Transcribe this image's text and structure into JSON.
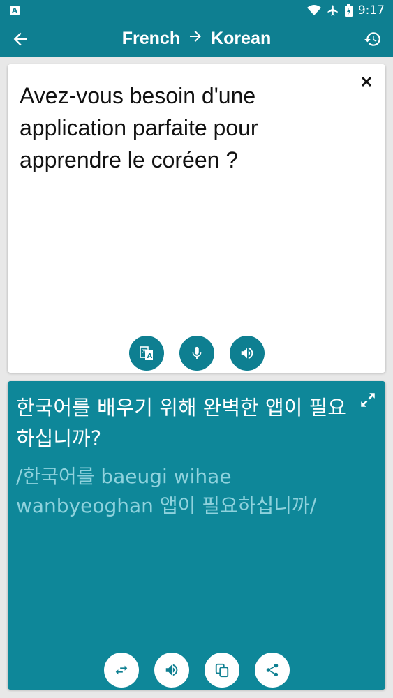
{
  "status": {
    "notification_icon": "app-notification-icon",
    "time": "9:17"
  },
  "appbar": {
    "source_language": "French",
    "target_language": "Korean",
    "back_icon": "arrow-left-icon",
    "arrow_icon": "arrow-right-icon",
    "history_icon": "history-icon"
  },
  "source": {
    "text": "Avez-vous besoin d'une application parfaite pour apprendre le coréen ?",
    "buttons": [
      "translate-icon",
      "microphone-icon",
      "speaker-icon"
    ]
  },
  "target": {
    "text": "한국어를 배우기 위해 완벽한 앱이 필요하십니까?",
    "romanization": "/한국어를 baeugi wihae wanbyeoghan 앱이 필요하십니까/",
    "buttons": [
      "swap-icon",
      "speaker-icon",
      "copy-icon",
      "share-icon"
    ]
  },
  "colors": {
    "primary": "#0e7f91",
    "target_card": "#0e8799",
    "romanization": "#8fd2dd"
  }
}
